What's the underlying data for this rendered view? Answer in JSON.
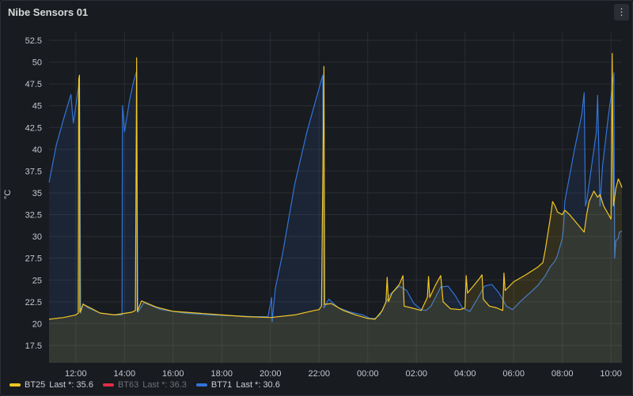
{
  "panel": {
    "title": "Nibe Sensors 01",
    "menu_icon": "kebab-menu-icon"
  },
  "colors": {
    "BT25": "#f2c624",
    "BT63": "#e02f44",
    "BT71": "#3274d9",
    "grid": "#2a2d33",
    "background": "#181b1f"
  },
  "legend": [
    {
      "name": "BT25",
      "last": "Last *: 35.6",
      "dim": false
    },
    {
      "name": "BT63",
      "last": "Last *: 36.3",
      "dim": true
    },
    {
      "name": "BT71",
      "last": "Last *: 30.6",
      "dim": false
    }
  ],
  "chart_data": {
    "type": "line",
    "title": "",
    "ylabel": "°C",
    "ylim": [
      15.5,
      53.5
    ],
    "xlim": [
      10.9,
      34.45
    ],
    "yticks": [
      "17.5",
      "20",
      "22.5",
      "25",
      "27.5",
      "30",
      "32.5",
      "35",
      "37.5",
      "40",
      "42.5",
      "45",
      "47.5",
      "50",
      "52.5"
    ],
    "xticks": [
      {
        "t": 12,
        "label": "12:00"
      },
      {
        "t": 14,
        "label": "14:00"
      },
      {
        "t": 16,
        "label": "16:00"
      },
      {
        "t": 18,
        "label": "18:00"
      },
      {
        "t": 20,
        "label": "20:00"
      },
      {
        "t": 22,
        "label": "22:00"
      },
      {
        "t": 24,
        "label": "00:00"
      },
      {
        "t": 26,
        "label": "02:00"
      },
      {
        "t": 28,
        "label": "04:00"
      },
      {
        "t": 30,
        "label": "06:00"
      },
      {
        "t": 32,
        "label": "08:00"
      },
      {
        "t": 34,
        "label": "10:00"
      }
    ],
    "grid": true,
    "legend_position": "bottom-left",
    "series": [
      {
        "name": "BT71",
        "points": [
          [
            10.9,
            36.2
          ],
          [
            11.2,
            40.5
          ],
          [
            11.5,
            43.5
          ],
          [
            11.8,
            46.3
          ],
          [
            11.85,
            44.5
          ],
          [
            11.9,
            43.0
          ],
          [
            12.0,
            45.0
          ],
          [
            12.1,
            47.0
          ],
          [
            12.15,
            48.0
          ],
          [
            12.2,
            21.2
          ],
          [
            12.3,
            22.3
          ],
          [
            12.5,
            21.8
          ],
          [
            13.0,
            21.2
          ],
          [
            13.6,
            21.0
          ],
          [
            13.9,
            21.0
          ],
          [
            13.92,
            45.0
          ],
          [
            13.95,
            44.0
          ],
          [
            14.0,
            42.0
          ],
          [
            14.2,
            45.5
          ],
          [
            14.35,
            47.5
          ],
          [
            14.5,
            49.0
          ],
          [
            14.55,
            21.3
          ],
          [
            14.8,
            22.4
          ],
          [
            15.5,
            21.6
          ],
          [
            16.5,
            21.2
          ],
          [
            17.5,
            21.0
          ],
          [
            18.5,
            20.9
          ],
          [
            19.3,
            20.8
          ],
          [
            19.9,
            20.8
          ],
          [
            20.05,
            23.0
          ],
          [
            20.07,
            20.2
          ],
          [
            20.2,
            24.0
          ],
          [
            20.5,
            28.0
          ],
          [
            21.0,
            36.0
          ],
          [
            21.5,
            42.0
          ],
          [
            21.9,
            46.0
          ],
          [
            22.15,
            48.5
          ],
          [
            22.2,
            21.8
          ],
          [
            22.4,
            22.8
          ],
          [
            22.8,
            21.8
          ],
          [
            23.3,
            21.3
          ],
          [
            23.8,
            21.0
          ],
          [
            24.1,
            20.6
          ],
          [
            24.3,
            20.6
          ],
          [
            24.5,
            21.0
          ],
          [
            24.9,
            23.3
          ],
          [
            25.3,
            24.3
          ],
          [
            25.6,
            23.8
          ],
          [
            25.9,
            22.3
          ],
          [
            26.2,
            21.6
          ],
          [
            26.4,
            21.5
          ],
          [
            26.6,
            22.0
          ],
          [
            27.0,
            24.2
          ],
          [
            27.3,
            24.3
          ],
          [
            27.6,
            23.2
          ],
          [
            27.9,
            21.8
          ],
          [
            28.2,
            21.4
          ],
          [
            28.5,
            22.8
          ],
          [
            28.8,
            24.3
          ],
          [
            29.1,
            24.5
          ],
          [
            29.4,
            23.5
          ],
          [
            29.7,
            22.0
          ],
          [
            29.95,
            21.6
          ],
          [
            30.3,
            22.6
          ],
          [
            30.7,
            23.6
          ],
          [
            31.0,
            24.4
          ],
          [
            31.3,
            25.5
          ],
          [
            31.5,
            26.5
          ],
          [
            31.7,
            27.2
          ],
          [
            31.8,
            27.8
          ],
          [
            32.0,
            29.8
          ],
          [
            32.05,
            31.0
          ],
          [
            32.1,
            34.0
          ],
          [
            32.5,
            40.0
          ],
          [
            32.8,
            44.0
          ],
          [
            32.9,
            46.5
          ],
          [
            32.95,
            33.5
          ],
          [
            33.0,
            34.0
          ],
          [
            33.4,
            42.0
          ],
          [
            33.45,
            46.2
          ],
          [
            33.5,
            40.0
          ],
          [
            33.55,
            33.5
          ],
          [
            33.65,
            38.0
          ],
          [
            33.9,
            44.0
          ],
          [
            34.05,
            47.0
          ],
          [
            34.12,
            48.8
          ],
          [
            34.15,
            27.5
          ],
          [
            34.2,
            29.5
          ],
          [
            34.3,
            29.8
          ],
          [
            34.35,
            30.5
          ],
          [
            34.45,
            30.6
          ]
        ]
      },
      {
        "name": "BT25",
        "points": [
          [
            10.9,
            20.5
          ],
          [
            11.5,
            20.7
          ],
          [
            12.0,
            21.0
          ],
          [
            12.1,
            21.2
          ],
          [
            12.12,
            48.0
          ],
          [
            12.15,
            48.5
          ],
          [
            12.17,
            21.3
          ],
          [
            12.3,
            22.2
          ],
          [
            12.6,
            21.8
          ],
          [
            13.0,
            21.2
          ],
          [
            13.6,
            21.0
          ],
          [
            14.3,
            21.3
          ],
          [
            14.45,
            21.5
          ],
          [
            14.5,
            50.5
          ],
          [
            14.53,
            21.4
          ],
          [
            14.7,
            22.6
          ],
          [
            15.3,
            21.9
          ],
          [
            16.0,
            21.4
          ],
          [
            17.0,
            21.2
          ],
          [
            18.0,
            21.0
          ],
          [
            19.0,
            20.8
          ],
          [
            20.0,
            20.7
          ],
          [
            21.0,
            21.0
          ],
          [
            21.8,
            21.5
          ],
          [
            22.0,
            21.6
          ],
          [
            22.1,
            22.0
          ],
          [
            22.2,
            49.5
          ],
          [
            22.23,
            22.2
          ],
          [
            22.5,
            22.3
          ],
          [
            23.0,
            21.5
          ],
          [
            23.5,
            21.0
          ],
          [
            24.0,
            20.6
          ],
          [
            24.3,
            20.5
          ],
          [
            24.6,
            21.5
          ],
          [
            24.75,
            22.5
          ],
          [
            24.8,
            25.3
          ],
          [
            24.85,
            22.5
          ],
          [
            25.0,
            23.5
          ],
          [
            25.3,
            24.5
          ],
          [
            25.45,
            25.5
          ],
          [
            25.5,
            22.0
          ],
          [
            25.8,
            21.8
          ],
          [
            26.2,
            21.5
          ],
          [
            26.45,
            23.0
          ],
          [
            26.5,
            25.4
          ],
          [
            26.55,
            23.0
          ],
          [
            26.8,
            24.5
          ],
          [
            27.0,
            25.5
          ],
          [
            27.1,
            22.5
          ],
          [
            27.4,
            21.7
          ],
          [
            27.8,
            21.6
          ],
          [
            28.0,
            21.8
          ],
          [
            28.05,
            25.5
          ],
          [
            28.1,
            23.5
          ],
          [
            28.4,
            24.5
          ],
          [
            28.6,
            25.2
          ],
          [
            28.7,
            25.6
          ],
          [
            28.75,
            22.8
          ],
          [
            29.0,
            22.0
          ],
          [
            29.3,
            21.8
          ],
          [
            29.55,
            21.5
          ],
          [
            29.6,
            25.8
          ],
          [
            29.65,
            23.8
          ],
          [
            30.0,
            24.8
          ],
          [
            30.5,
            25.6
          ],
          [
            31.0,
            26.5
          ],
          [
            31.2,
            27.0
          ],
          [
            31.3,
            28.5
          ],
          [
            31.5,
            32.0
          ],
          [
            31.6,
            34.0
          ],
          [
            31.7,
            33.5
          ],
          [
            31.8,
            32.8
          ],
          [
            32.0,
            32.5
          ],
          [
            32.1,
            33.0
          ],
          [
            32.3,
            32.5
          ],
          [
            32.6,
            31.5
          ],
          [
            32.9,
            30.5
          ],
          [
            32.95,
            31.5
          ],
          [
            33.0,
            32.5
          ],
          [
            33.1,
            34.0
          ],
          [
            33.3,
            35.2
          ],
          [
            33.45,
            34.5
          ],
          [
            33.55,
            34.8
          ],
          [
            33.7,
            33.5
          ],
          [
            33.9,
            32.5
          ],
          [
            34.0,
            32.0
          ],
          [
            34.05,
            51.0
          ],
          [
            34.1,
            33.5
          ],
          [
            34.2,
            35.5
          ],
          [
            34.3,
            36.6
          ],
          [
            34.4,
            36.0
          ],
          [
            34.45,
            35.6
          ]
        ]
      }
    ]
  }
}
